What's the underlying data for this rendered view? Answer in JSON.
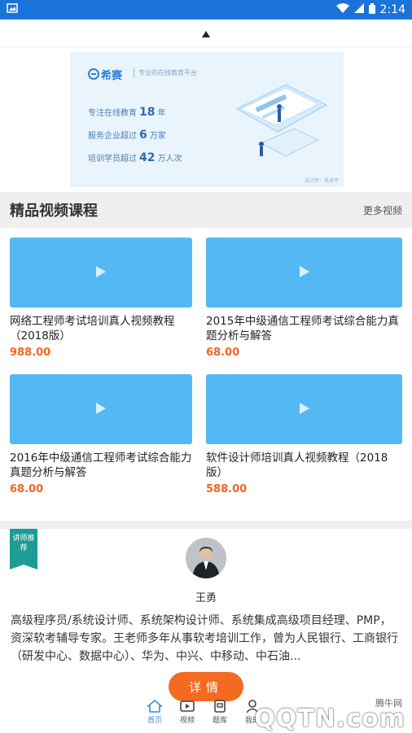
{
  "status_bar": {
    "time": "2:14"
  },
  "banner": {
    "brand": "希赛",
    "tagline": "专业的在线教育平台",
    "line1_prefix": "专注在线教育",
    "line1_num": "18",
    "line1_suffix": "年",
    "line2_prefix": "服务企业超过",
    "line2_num": "6",
    "line2_suffix": "万家",
    "line3_prefix": "培训学员超过",
    "line3_num": "42",
    "line3_suffix": "万人次",
    "credit": "设计师：朱张平"
  },
  "section": {
    "title": "精品视频课程",
    "more": "更多视频"
  },
  "courses": [
    {
      "title": "网络工程师考试培训真人视频教程（2018版）",
      "price": "988.00"
    },
    {
      "title": "2015年中级通信工程师考试综合能力真题分析与解答",
      "price": "68.00"
    },
    {
      "title": "2016年中级通信工程师考试综合能力真题分析与解答",
      "price": "68.00"
    },
    {
      "title": "软件设计师培训真人视频教程（2018版）",
      "price": "588.00"
    }
  ],
  "teacher": {
    "badge": "讲师推荐",
    "name": "王勇",
    "description": "高级程序员/系统设计师、系统架构设计师、系统集成高级项目经理、PMP，资深软考辅导专家。王老师多年从事软考培训工作，曾为人民银行、工商银行（研发中心、数据中心）、华为、中兴、中移动、中石油...",
    "detail_button": "详情"
  },
  "bottom_nav": [
    {
      "label": "首页",
      "icon": "home-icon",
      "active": true
    },
    {
      "label": "视频",
      "icon": "video-icon",
      "active": false
    },
    {
      "label": "题库",
      "icon": "question-bank-icon",
      "active": false
    },
    {
      "label": "我的",
      "icon": "profile-icon",
      "active": false
    }
  ],
  "watermark": {
    "small": "腾牛网",
    "big": "QQTN.com"
  },
  "colors": {
    "status_bar": "#1a73d9",
    "thumb": "#54b9f3",
    "price": "#f26522",
    "button": "#f36b22",
    "badge": "#1b9c95",
    "active_nav": "#3a8ee6"
  }
}
